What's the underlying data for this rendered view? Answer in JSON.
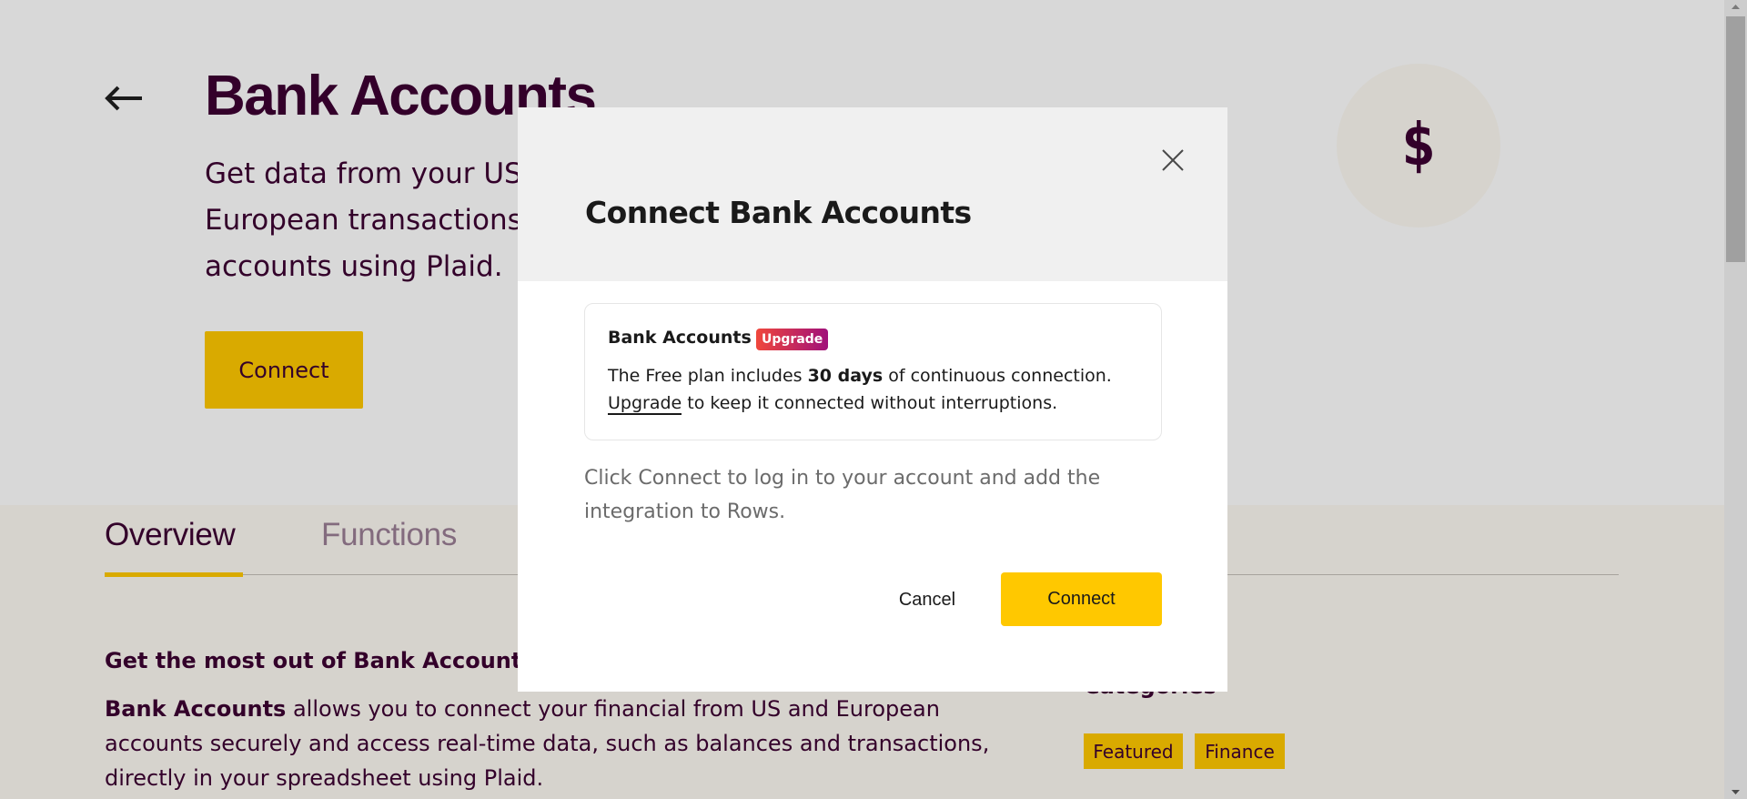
{
  "page": {
    "back_icon": "arrow-left-icon",
    "title": "Bank Accounts",
    "subtitle": "Get data from your US and European transactions and accounts using Plaid.",
    "connect_label": "Connect",
    "hero_icon": "dollar-icon",
    "hero_icon_glyph": "$"
  },
  "tabs": [
    {
      "label": "Overview",
      "active": true
    },
    {
      "label": "Functions",
      "active": false
    }
  ],
  "overview": {
    "heading": "Get the most out of Bank Accounts",
    "body_bold": "Bank Accounts",
    "body_rest": " allows you to connect your financial from US and European accounts securely and access real-time data, such as balances and transactions, directly in your spreadsheet using Plaid.",
    "categories_label": "Categories",
    "tags": [
      "Featured",
      "Finance"
    ]
  },
  "modal": {
    "title": "Connect Bank Accounts",
    "close_icon": "close-icon",
    "card": {
      "title": "Bank Accounts",
      "badge": "Upgrade",
      "line1_pre": "The Free plan includes ",
      "line1_bold": "30 days",
      "line1_post": " of continuous connection.",
      "line2_link": "Upgrade",
      "line2_post": " to keep it connected without interruptions."
    },
    "help_text": "Click Connect to log in to your account and add the integration to Rows.",
    "cancel_label": "Cancel",
    "connect_label": "Connect"
  },
  "colors": {
    "brand_text": "#33002a",
    "accent_yellow": "#d9aa00",
    "modal_button": "#ffc800",
    "badge_gradient_start": "#f0473c",
    "badge_gradient_end": "#a0107a"
  }
}
